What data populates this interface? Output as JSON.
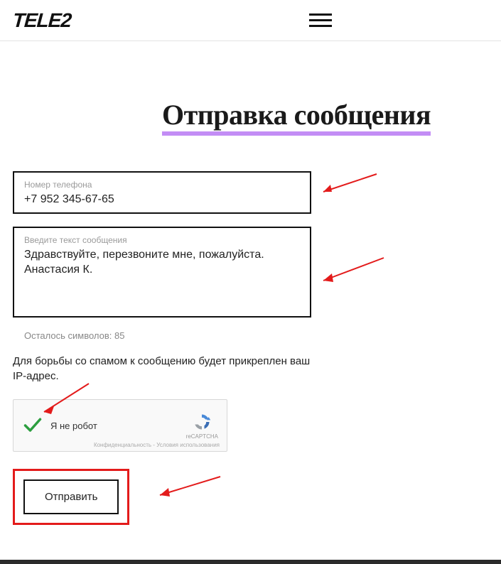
{
  "header": {
    "logo_text": "TELE2"
  },
  "page": {
    "title": "Отправка сообщения"
  },
  "form": {
    "phone": {
      "label": "Номер телефона",
      "value": "+7 952 345-67-65"
    },
    "message": {
      "label": "Введите текст сообщения",
      "value": "Здравствуйте, перезвоните мне, пожалуйста. Анастасия К."
    },
    "remaining_label": "Осталось символов: 85",
    "ip_notice": "Для борьбы со спамом к сообщению будет прикреплен ваш IP-адрес.",
    "submit_label": "Отправить"
  },
  "captcha": {
    "label": "Я не робот",
    "product": "reCAPTCHA",
    "legal": "Конфиденциальность - Условия использования"
  }
}
